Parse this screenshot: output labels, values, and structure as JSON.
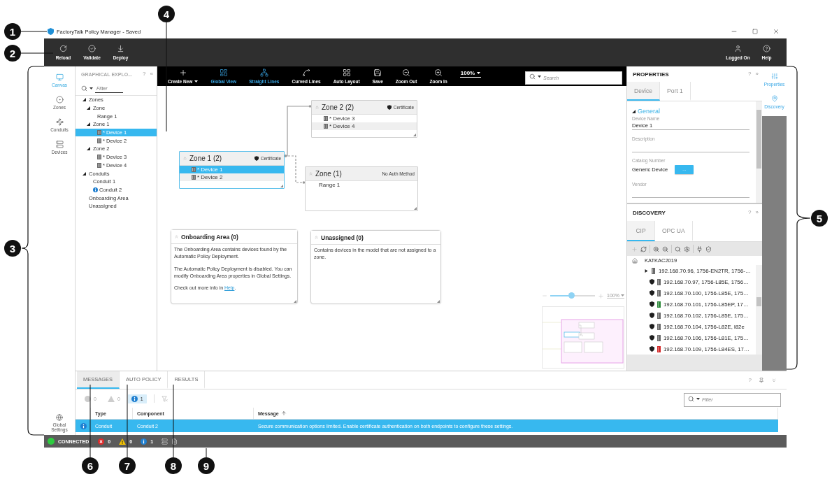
{
  "callouts": [
    {
      "number": "1",
      "kind": "leader"
    },
    {
      "number": "2",
      "kind": "leader"
    },
    {
      "number": "3",
      "kind": "bracket"
    },
    {
      "number": "4",
      "kind": "leader"
    },
    {
      "number": "5",
      "kind": "bracket"
    },
    {
      "number": "6",
      "kind": "leader"
    },
    {
      "number": "7",
      "kind": "leader"
    },
    {
      "number": "8",
      "kind": "leader"
    },
    {
      "number": "9",
      "kind": "leader"
    }
  ],
  "window": {
    "title": "FactoryTalk Policy Manager - Saved"
  },
  "toolbar": {
    "actions": [
      {
        "label": "Reload"
      },
      {
        "label": "Validate"
      },
      {
        "label": "Deploy"
      }
    ],
    "account": [
      {
        "label": "Logged On"
      },
      {
        "label": "Help"
      }
    ]
  },
  "nav_rail": {
    "items": [
      {
        "label": "Canvas",
        "selected": true
      },
      {
        "label": "Zones",
        "selected": false
      },
      {
        "label": "Conduits",
        "selected": false
      },
      {
        "label": "Devices",
        "selected": false
      }
    ],
    "footer": {
      "label": "Global Settings"
    }
  },
  "explorer": {
    "title": "GRAPHICAL EXPLO...",
    "help": "?",
    "collapse": "«",
    "filter": {
      "placeholder": "Filter"
    },
    "tree": [
      {
        "label": "Zones",
        "selected": false,
        "expanded": true,
        "children": [
          {
            "label": "Zone",
            "selected": false,
            "expanded": true,
            "children": [
              {
                "label": "Range 1",
                "kind": "range",
                "selected": false
              }
            ]
          },
          {
            "label": "Zone 1",
            "selected": false,
            "expanded": true,
            "children": [
              {
                "label": "* Device 1",
                "kind": "device",
                "selected": true
              },
              {
                "label": "* Device 2",
                "kind": "device",
                "selected": false
              }
            ]
          },
          {
            "label": "Zone 2",
            "selected": false,
            "expanded": true,
            "children": [
              {
                "label": "* Device 3",
                "kind": "device",
                "selected": false
              },
              {
                "label": "* Device 4",
                "kind": "device",
                "selected": false
              }
            ]
          }
        ]
      },
      {
        "label": "Conduits",
        "selected": false,
        "expanded": true,
        "children": [
          {
            "label": "Conduit 1",
            "selected": false,
            "info": false
          },
          {
            "label": "Conduit 2",
            "selected": false,
            "info": true
          }
        ]
      },
      {
        "label": "Onboarding Area",
        "selected": false
      },
      {
        "label": "Unassigned",
        "selected": false
      }
    ]
  },
  "canvas": {
    "toolbar": {
      "tools": [
        {
          "label": "Create New",
          "kind": "menu",
          "selected": false
        },
        {
          "label": "Global View",
          "kind": "button",
          "selected": true
        },
        {
          "label": "Straight Lines",
          "kind": "button",
          "selected": true
        },
        {
          "label": "Curved Lines",
          "kind": "button",
          "selected": false
        },
        {
          "label": "Auto Layout",
          "kind": "button",
          "selected": false
        },
        {
          "label": "Save",
          "kind": "button",
          "selected": false
        },
        {
          "label": "Zoom Out",
          "kind": "button",
          "selected": false
        },
        {
          "label": "Zoom In",
          "kind": "button",
          "selected": false
        }
      ],
      "zoom": "100%",
      "search": {
        "placeholder": "Search"
      }
    },
    "zones": [
      {
        "title": "Zone 2 (2)",
        "auth": "Certificate",
        "secured": true,
        "selected": false,
        "items": [
          {
            "label": "* Device 3",
            "kind": "device",
            "selected": false
          },
          {
            "label": "* Device 4",
            "kind": "device",
            "selected": false
          }
        ]
      },
      {
        "title": "Zone 1 (2)",
        "auth": "Certificate",
        "secured": true,
        "selected": true,
        "items": [
          {
            "label": "* Device 1",
            "kind": "device",
            "selected": true
          },
          {
            "label": "* Device 2",
            "kind": "device",
            "selected": false
          }
        ]
      },
      {
        "title": "Zone (1)",
        "auth": "No Auth Method",
        "secured": false,
        "selected": false,
        "items": [
          {
            "label": "Range 1",
            "kind": "range",
            "selected": false
          }
        ]
      }
    ],
    "connections": [
      {
        "kind": "solid"
      },
      {
        "kind": "dashed"
      }
    ],
    "areas": [
      {
        "title": "Onboarding Area (0)",
        "paragraphs": [
          {
            "text": "The Onboarding Area contains devices found by the Automatic Policy Deployment."
          },
          {
            "text": "The Automatic Policy Deployment is disabled. You can modify Onboarding Area properties in Global Settings."
          },
          {
            "text": "Check out more info in ",
            "link": "Help",
            "after": "."
          }
        ]
      },
      {
        "title": "Unassigned (0)",
        "paragraphs": [
          {
            "text": "Contains devices in the model that are not assigned to a zone."
          }
        ]
      }
    ],
    "zoom_control": {
      "level": 0.47,
      "reading": "100%"
    }
  },
  "properties": {
    "title": "PROPERTIES",
    "help": "?",
    "collapse": "»",
    "tabs": [
      {
        "label": "Device",
        "selected": true
      },
      {
        "label": "Port 1",
        "selected": false
      }
    ],
    "section": {
      "label": "General",
      "expanded": true
    },
    "fields": [
      {
        "label": "Device Name",
        "kind": "text",
        "value": "Device 1"
      },
      {
        "label": "Description",
        "kind": "text"
      },
      {
        "label": "Catalog Number",
        "kind": "picker",
        "value": "Generic Device",
        "button": "..."
      },
      {
        "label": "Vendor",
        "kind": "text"
      }
    ]
  },
  "discovery": {
    "title": "DISCOVERY",
    "help": "?",
    "collapse": "»",
    "tabs": [
      {
        "label": "CIP",
        "selected": true
      },
      {
        "label": "OPC UA",
        "selected": false
      }
    ],
    "tools": [
      {
        "disabled": true
      },
      {
        "disabled": false
      },
      {
        "disabled": false
      },
      {
        "disabled": false
      },
      {
        "disabled": false
      },
      {
        "disabled": false
      },
      {
        "disabled": false
      },
      {
        "disabled": false
      }
    ],
    "root": "KATKAC2019",
    "rows": [
      {
        "label": "192.168.70.96, 1756-EN2TR, 1756-…",
        "kind": "adapter",
        "expanded": false,
        "color": "#6b6b6b"
      },
      {
        "label": "192.168.70.97, 1756-L85E, 1756…",
        "kind": "controller",
        "color": "#6b6b6b"
      },
      {
        "label": "192.168.70.100, 1756-L85E, 175…",
        "kind": "controller",
        "color": "#6b6b6b"
      },
      {
        "label": "192.168.70.101, 1756-L85EP, 17…",
        "kind": "controller",
        "color": "#2f8a3c"
      },
      {
        "label": "192.168.70.102, 1756-L85E, 175…",
        "kind": "controller",
        "color": "#6b6b6b"
      },
      {
        "label": "192.168.70.104, 1756-L82E, l82e",
        "kind": "controller",
        "color": "#6b6b6b"
      },
      {
        "label": "192.168.70.106, 1756-L81E, 175…",
        "kind": "controller",
        "color": "#6b6b6b"
      },
      {
        "label": "192.168.70.109, 1756-L84ES, 17…",
        "kind": "controller",
        "color": "#d42a2a"
      }
    ]
  },
  "side_tabs": [
    {
      "label": "Properties",
      "selected": true
    },
    {
      "label": "Discovery",
      "selected": true
    }
  ],
  "bottom_panel": {
    "tabs": [
      {
        "label": "MESSAGES",
        "selected": true
      },
      {
        "label": "AUTO POLICY",
        "selected": false
      },
      {
        "label": "RESULTS",
        "selected": false
      }
    ],
    "help": "?",
    "counters": [
      {
        "kind": "error",
        "count": "0",
        "selected": false
      },
      {
        "kind": "warning",
        "count": "0",
        "selected": false
      },
      {
        "kind": "info",
        "count": "1",
        "selected": true
      }
    ],
    "filter": {
      "placeholder": "Filter"
    },
    "columns": [
      {
        "label": "Type",
        "sorted": false
      },
      {
        "label": "Component",
        "sorted": false
      },
      {
        "label": "Message",
        "sorted": true
      }
    ],
    "rows": [
      {
        "kind": "info",
        "type": "Conduit",
        "component": "Conduit 2",
        "message": "Secure communication options limited. Enable certificate authentication on both endpoints to configure these settings.",
        "selected": true
      }
    ]
  },
  "status_bar": {
    "connected": true,
    "label": "CONNECTED",
    "counters": [
      {
        "kind": "error",
        "count": "0"
      },
      {
        "kind": "warning",
        "count": "0"
      },
      {
        "kind": "info",
        "count": "1"
      }
    ]
  }
}
